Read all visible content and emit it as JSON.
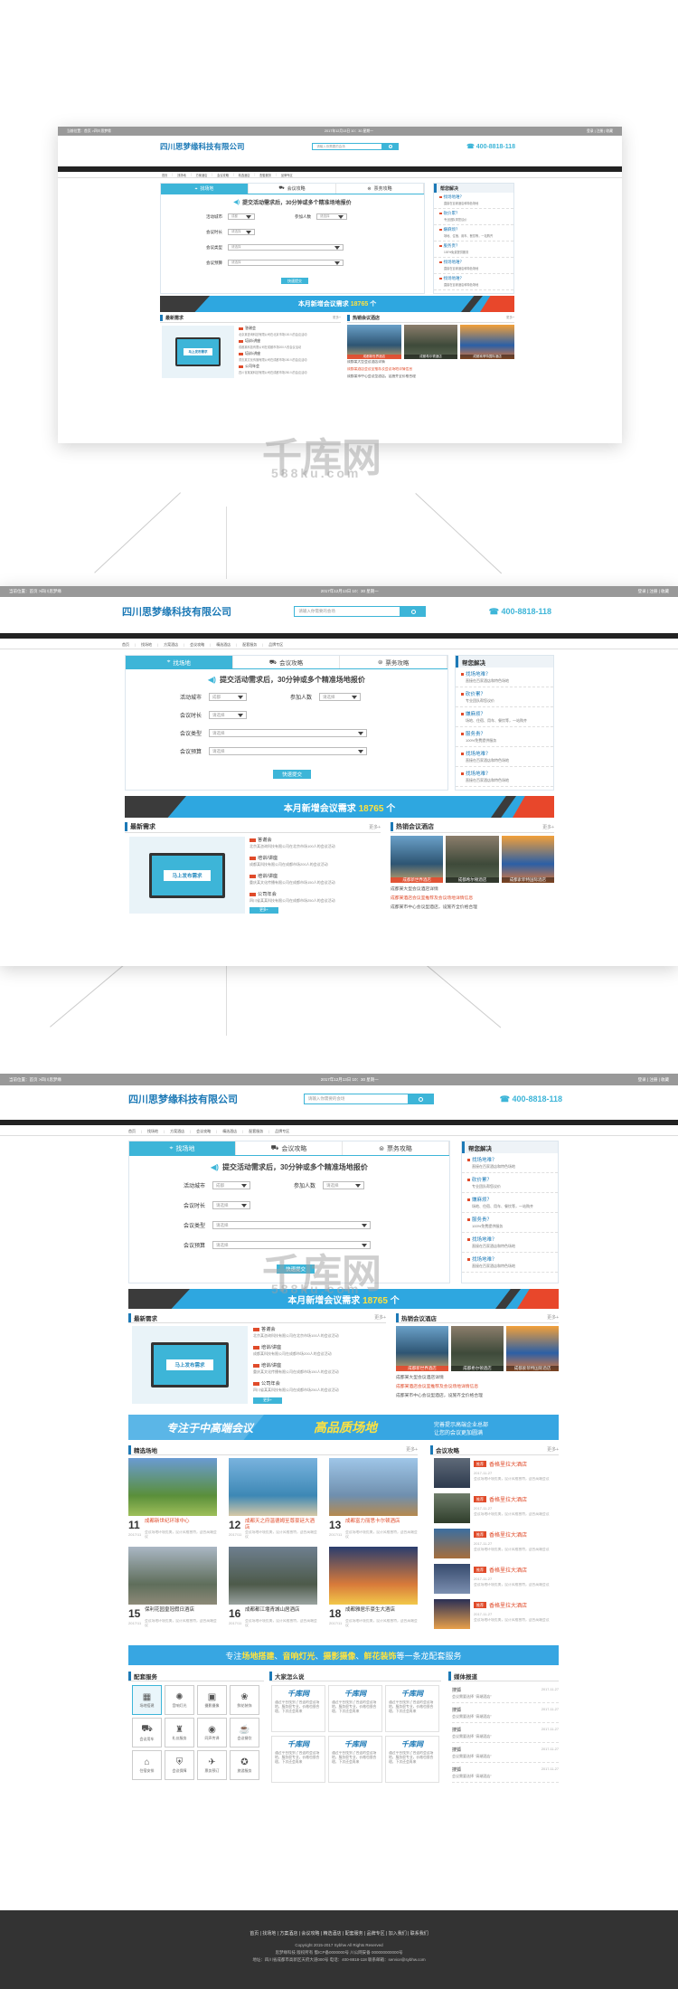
{
  "topbar": {
    "left": "当前位置：首页 >四川思梦缘",
    "center": "2017年12月13日 10：30 星期一",
    "right": "登录 | 注册 | 收藏"
  },
  "brand": {
    "company": "四川思梦缘科技有限公司",
    "phone": "400-8818-118",
    "search_placeholder": "请输入你需要的会场"
  },
  "nav": [
    "首页",
    "找场地",
    "方案酒店",
    "会议攻略",
    "精选酒店",
    "配套服务",
    "品牌专区"
  ],
  "crumb": [
    "首页",
    "找场地",
    "方案酒店",
    "会议攻略",
    "精选酒店",
    "配套服务",
    "品牌专区"
  ],
  "tabs": [
    "找场地",
    "会议攻略",
    "票务攻略"
  ],
  "form": {
    "title": "提交活动需求后，30分钟或多个精准场地报价",
    "city_label": "活动城市",
    "city_value": "成都",
    "people_label": "参加人数",
    "people_value": "请选择",
    "duration_label": "会议时长",
    "duration_value": "请选择",
    "type_label": "会议类型",
    "type_value": "请选择",
    "budget_label": "会议预算",
    "budget_value": "请选择",
    "submit": "快速提交"
  },
  "help": {
    "title": "帮您解决",
    "items": [
      {
        "q": "找场地难？",
        "a": "直接在百家酒店和特色场地"
      },
      {
        "q": "砍价累？",
        "a": "专业团队帮您议价"
      },
      {
        "q": "嫌麻烦？",
        "a": "场地、住宿、用车、餐饮等，一站购齐"
      },
      {
        "q": "服务贵？",
        "a": "100%免费提供服务"
      },
      {
        "q": "找场地难？",
        "a": "直接在百家酒店和特色场地"
      },
      {
        "q": "找场地难？",
        "a": "直接在百家酒店和特色场地"
      }
    ]
  },
  "banner": {
    "prefix": "本月新增会议需求",
    "count": "18765",
    "suffix": "个"
  },
  "latest": {
    "title": "最新需求",
    "more": "更多+",
    "cta": "马上发布需求",
    "items": [
      {
        "h": "答谢会",
        "d": "北京某咨询科技有限公司在北京市场100人的会议活动"
      },
      {
        "h": "培训/讲座",
        "d": "成都某科技有限公司在成都市场200人的会议活动"
      },
      {
        "h": "培训/讲座",
        "d": "重庆某文化传播有限公司在成都市场150人的会议活动"
      },
      {
        "h": "公司年会",
        "d": "四川省某某科技有限公司在成都市场250人的会议活动"
      }
    ]
  },
  "hot": {
    "title": "热销会议酒店",
    "more": "更多+",
    "captions": [
      "成都新世界酒店",
      "成都希尔顿酒店",
      "成都索菲特国际酒店"
    ],
    "lines": [
      "成都某大型会议酒店详情",
      "成都某酒店会议室推荐及会议场地详情信息",
      "成都某市中心会议型酒店，设施齐全价格合理"
    ]
  },
  "promo": {
    "left": "专注于中高端会议",
    "mid": "高品质场地",
    "r1": "完善提示高端企业总部",
    "r2": "让您的会议更加圆满"
  },
  "featured": {
    "title": "精选场地",
    "more": "更多+",
    "venues": [
      {
        "num": "11",
        "title": "成都新世纪环球中心",
        "date": "2017/11"
      },
      {
        "num": "12",
        "title": "成都天之府温德姆至尊豪廷大酒店",
        "date": "2017/11"
      },
      {
        "num": "13",
        "title": "成都富力丽思卡尔顿酒店",
        "date": "2017/11"
      },
      {
        "num": "15",
        "title": "保利花园皇冠假日酒店",
        "date": "2017/11"
      },
      {
        "num": "16",
        "title": "成都都江堰青城山居酒店",
        "date": "2017/11"
      },
      {
        "num": "18",
        "title": "成都雅居乐豪生大酒店",
        "date": "2017/11"
      }
    ],
    "desc": "会议场地环境优美，设计风格独特，适合高端会议"
  },
  "guide": {
    "title": "会议攻略",
    "more": "更多+",
    "tag": "推荐",
    "items": [
      {
        "t": "香格里拉大酒店",
        "d": "2017-11-27"
      },
      {
        "t": "香格里拉大酒店",
        "d": "2017-11-27"
      },
      {
        "t": "香格里拉大酒店",
        "d": "2017-11-27"
      },
      {
        "t": "香格里拉大酒店",
        "d": "2017-11-27"
      },
      {
        "t": "香格里拉大酒店",
        "d": "2017-11-27"
      }
    ]
  },
  "svc": {
    "pre": "专注",
    "k1": "场地搭建",
    "k2": "音响灯光",
    "k3": "摄影摄像",
    "k4": "鲜花装饰",
    "post": "等一条龙配套服务"
  },
  "support": {
    "title": "配套服务",
    "icons": [
      "场地搭建",
      "音响灯光",
      "摄影摄像",
      "鲜花装饰",
      "会议用车",
      "礼仪服务",
      "同声传译",
      "会议餐饮",
      "住宿安排",
      "会议保障",
      "票务预订",
      "旅游服务"
    ]
  },
  "reviews": {
    "title": "大家怎么说",
    "logo": "千库网",
    "text": "通过平台找到了合适的会议场地，服务很专业，价格也很合理，下次还会再来"
  },
  "media": {
    "title": "媒体报道",
    "items": [
      {
        "a": "搜狐",
        "b": "会议需要选择 \"高端酒店\"",
        "c": "2017-11-27"
      },
      {
        "a": "搜狐",
        "b": "会议需要选择 \"高端酒店\"",
        "c": "2017-11-27"
      },
      {
        "a": "搜狐",
        "b": "会议需要选择 \"高端酒店\"",
        "c": "2017-11-27"
      },
      {
        "a": "搜狐",
        "b": "会议需要选择 \"高端酒店\"",
        "c": "2017-11-27"
      },
      {
        "a": "搜狐",
        "b": "会议需要选择 \"高端酒店\"",
        "c": "2017-11-27"
      }
    ]
  },
  "footer": {
    "links": "首页 | 找场地 | 方案酒店 | 会议攻略 | 精选酒店 | 配套服务 | 品牌专区 | 加入我们 | 联系我们",
    "copy": "Copyright 2015-2017 Sybhw All Rights Reserved",
    "icp": "思梦缘科技 版权所有 蜀ICP备0000000号 川公网安备 000000000000号",
    "addr": "地址：四川省成都市高新区天府大道000号  电话：400-8818-118  联系邮箱：service@sybhw.com"
  },
  "watermark": {
    "text": "千库网",
    "sub": "588ku.com"
  }
}
